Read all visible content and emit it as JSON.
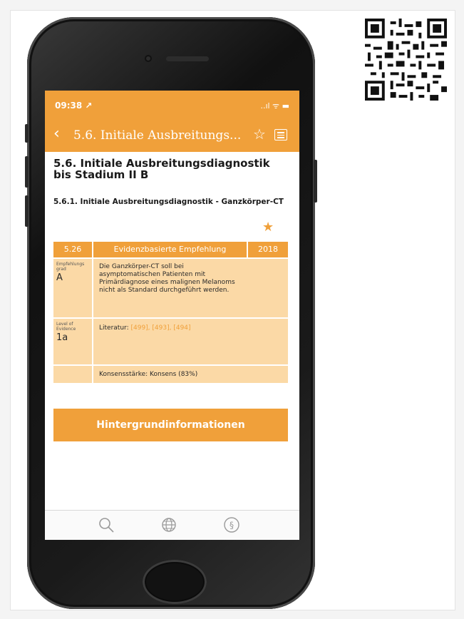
{
  "phone": {
    "status_bar": {
      "time": "09:38 ↗",
      "indicators": "..ıl ᯤ ▬"
    },
    "nav_bar": {
      "back_icon": "chevron-left",
      "title": "5.6. Initiale Ausbreitungs...",
      "star_icon": "star-outline",
      "list_icon": "list"
    },
    "section_title": "5.6. Initiale Ausbreitungsdiagnostik bis Stadium II B",
    "subsection_title": "5.6.1. Initiale Ausbreitungsdiagnostik - Ganzkörper-CT",
    "recommendation": {
      "number": "5.26",
      "type": "Evidenzbasierte Empfehlung",
      "year": "2018",
      "grade_label": "Empfehlungs grad",
      "grade": "A",
      "text": "Die Ganzkörper-CT soll bei asymptomatischen Patienten mit Primärdiagnose eines malignen Melanoms nicht als Standard durchgeführt werden.",
      "evidence_label": "Level of Evidence",
      "evidence": "1a",
      "literature_label": "Literatur:",
      "literature_refs": "[499], [493], [494]",
      "consensus": "Konsensstärke: Konsens (83%)"
    },
    "background_button": "Hintergrundinformationen",
    "tab_bar": [
      "search",
      "globe",
      "paragraph"
    ]
  },
  "colors": {
    "accent": "#f0a03a",
    "table_fill": "#fbd9a6"
  }
}
